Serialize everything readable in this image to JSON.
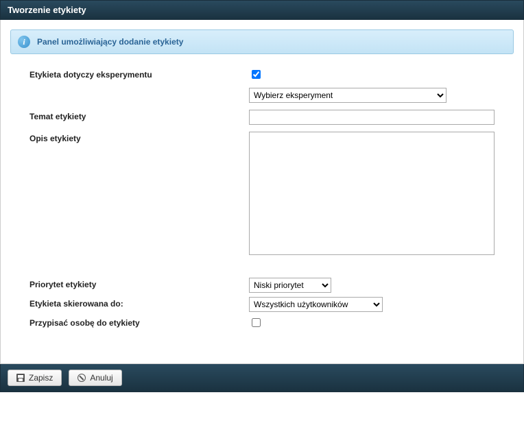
{
  "header": {
    "title": "Tworzenie etykiety"
  },
  "info": {
    "text": "Panel umożliwiający dodanie etykiety"
  },
  "form": {
    "experiment_label": "Etykieta dotyczy eksperymentu",
    "experiment_checked": true,
    "experiment_select_placeholder": "Wybierz eksperyment",
    "subject_label": "Temat etykiety",
    "subject_value": "",
    "desc_label": "Opis etykiety",
    "desc_value": "",
    "priority_label": "Priorytet etykiety",
    "priority_value": "Niski priorytet",
    "target_label": "Etykieta skierowana do:",
    "target_value": "Wszystkich użytkowników",
    "assign_label": "Przypisać osobę do etykiety",
    "assign_checked": false
  },
  "footer": {
    "save": "Zapisz",
    "cancel": "Anuluj"
  }
}
